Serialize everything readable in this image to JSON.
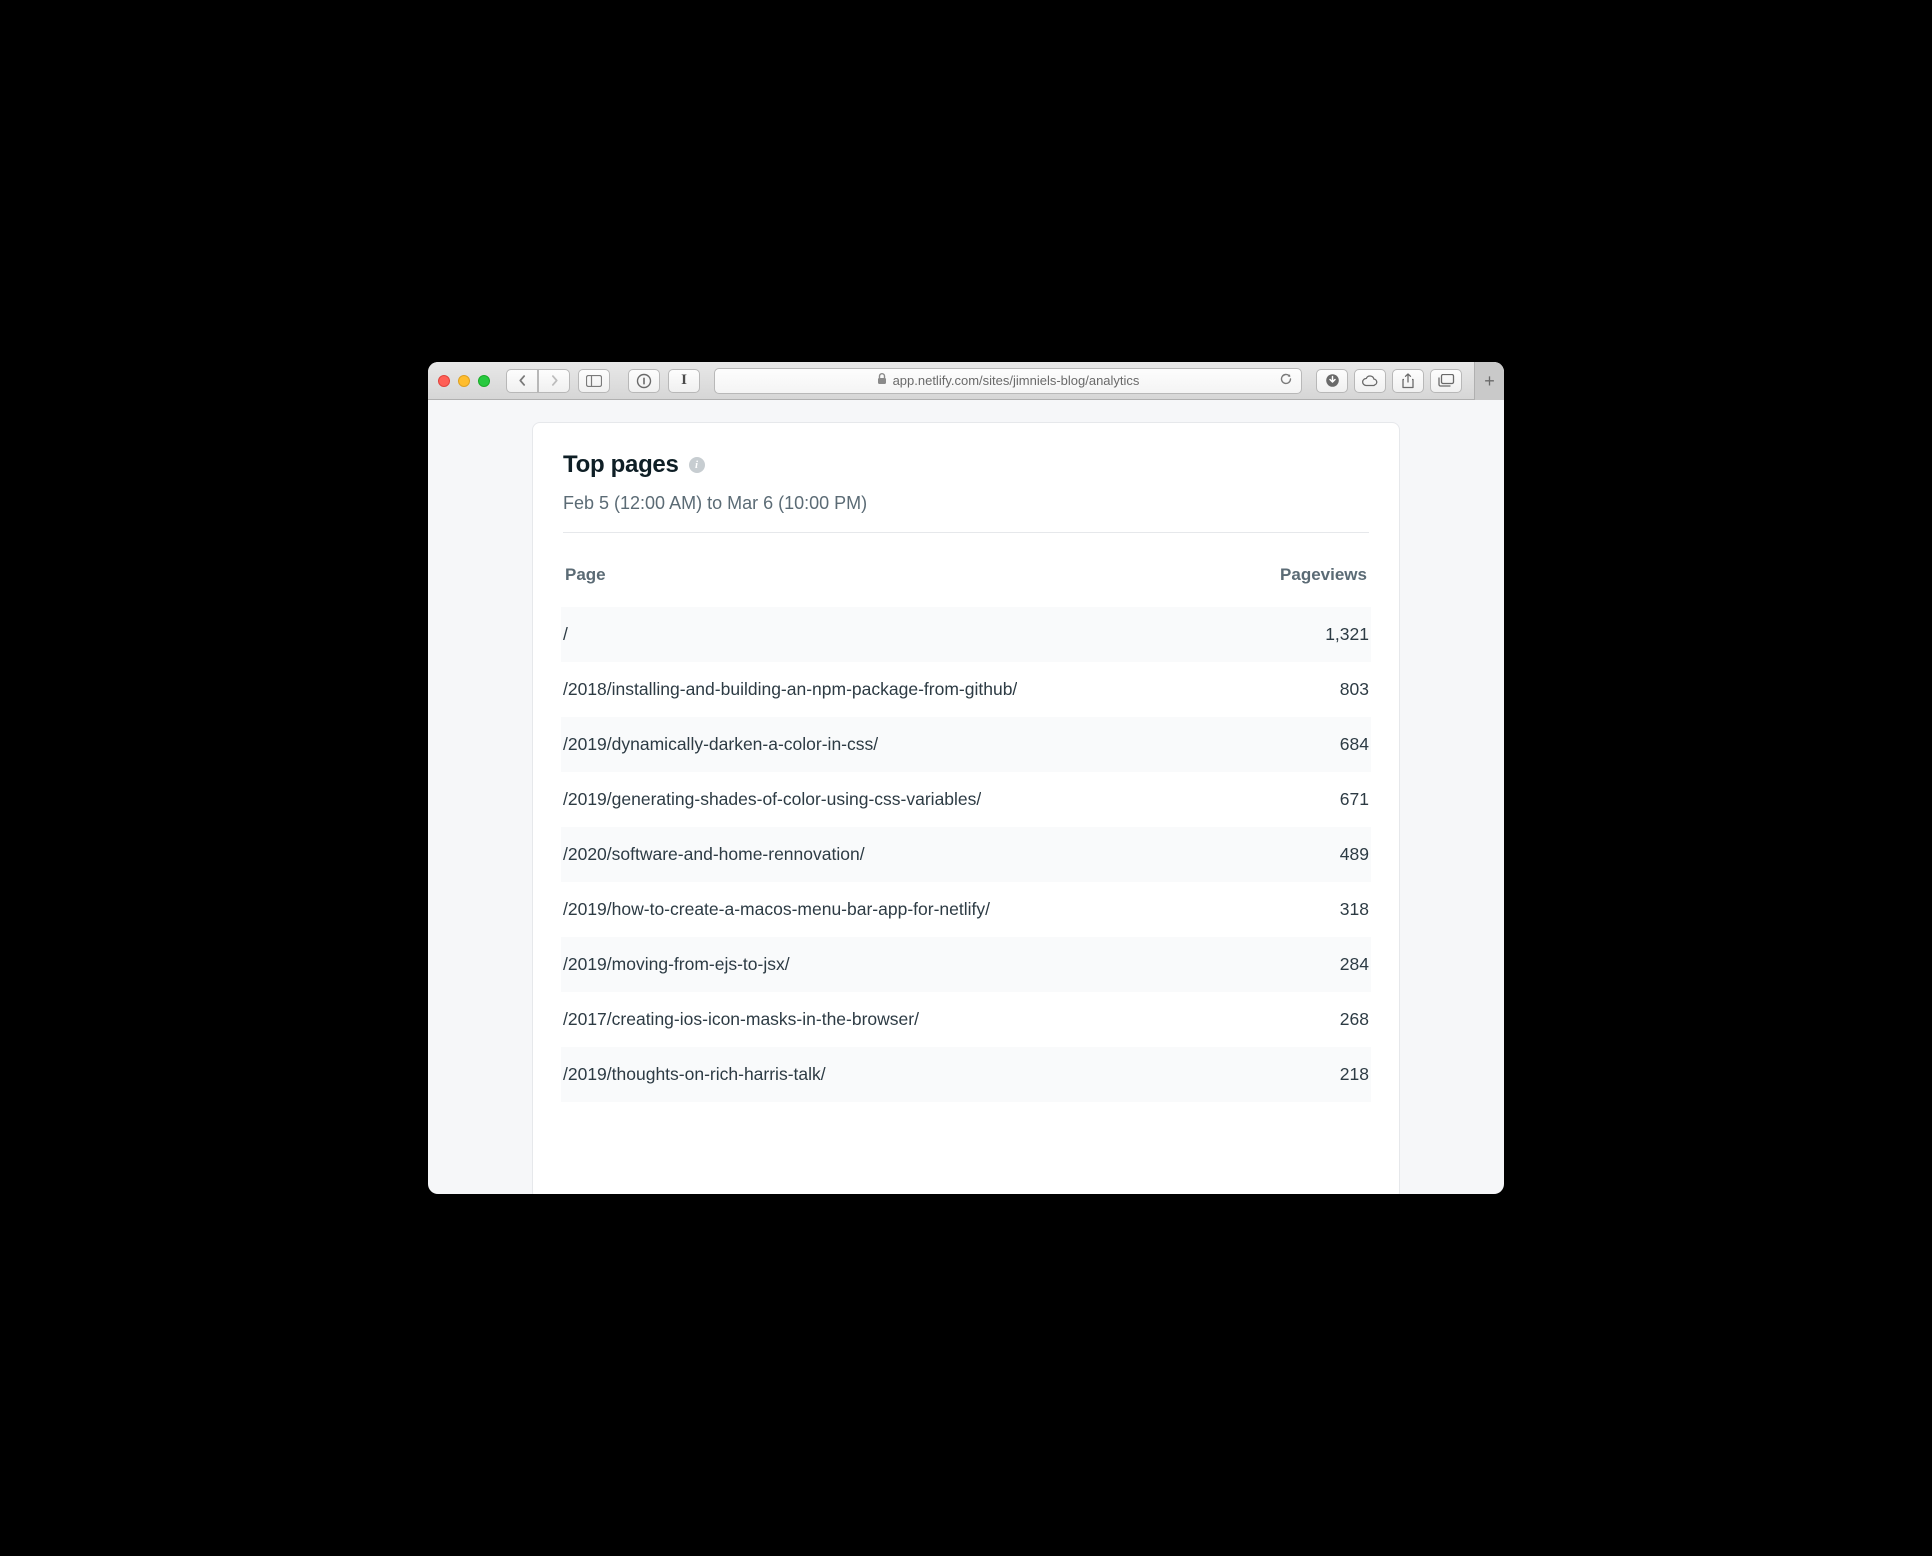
{
  "browser": {
    "url": "app.netlify.com/sites/jimniels-blog/analytics"
  },
  "card": {
    "title": "Top pages",
    "date_range": "Feb 5 (12:00 AM) to Mar 6 (10:00 PM)",
    "columns": {
      "page": "Page",
      "views": "Pageviews"
    },
    "rows": [
      {
        "page": "/",
        "views": "1,321"
      },
      {
        "page": "/2018/installing-and-building-an-npm-package-from-github/",
        "views": "803"
      },
      {
        "page": "/2019/dynamically-darken-a-color-in-css/",
        "views": "684"
      },
      {
        "page": "/2019/generating-shades-of-color-using-css-variables/",
        "views": "671"
      },
      {
        "page": "/2020/software-and-home-rennovation/",
        "views": "489"
      },
      {
        "page": "/2019/how-to-create-a-macos-menu-bar-app-for-netlify/",
        "views": "318"
      },
      {
        "page": "/2019/moving-from-ejs-to-jsx/",
        "views": "284"
      },
      {
        "page": "/2017/creating-ios-icon-masks-in-the-browser/",
        "views": "268"
      },
      {
        "page": "/2019/thoughts-on-rich-harris-talk/",
        "views": "218"
      }
    ]
  }
}
